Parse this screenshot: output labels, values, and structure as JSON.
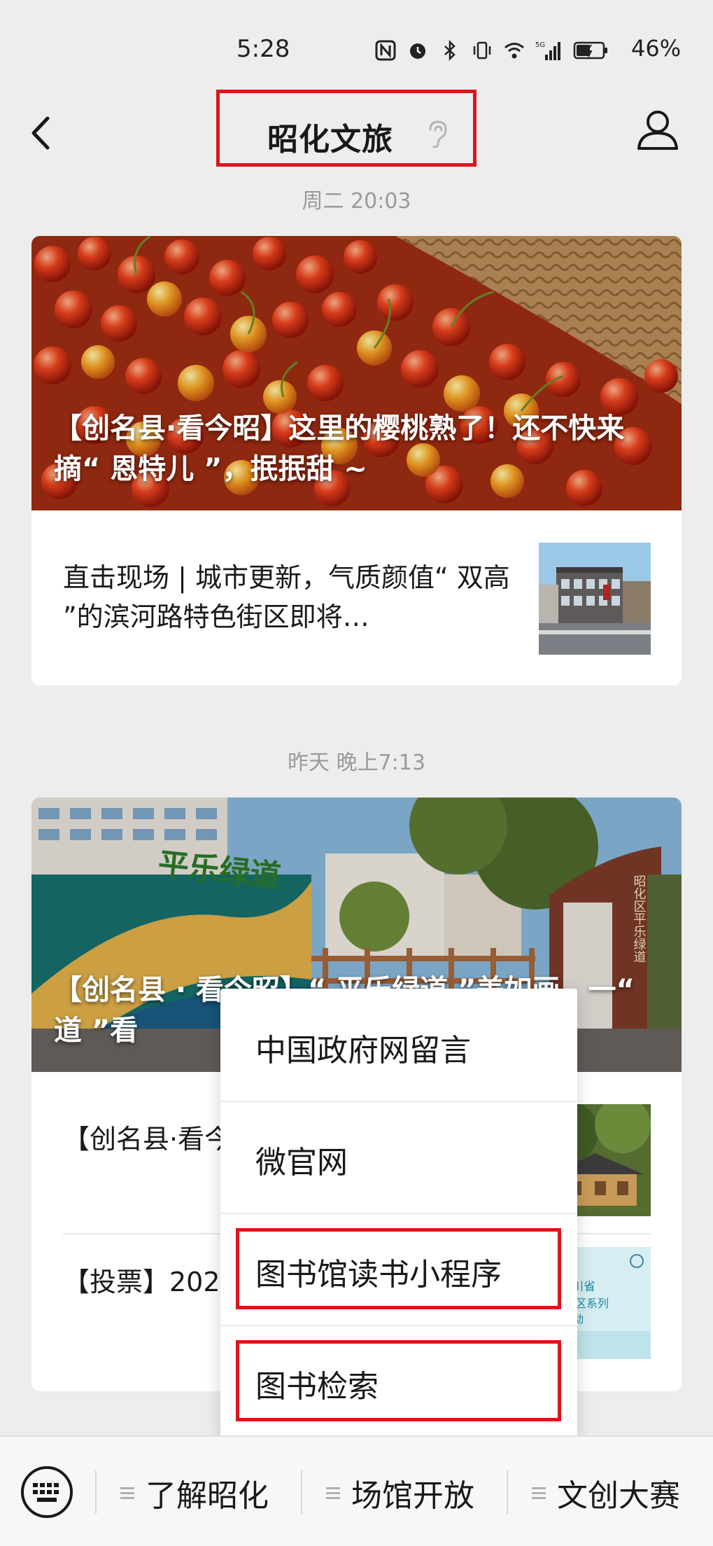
{
  "status_bar": {
    "time": "5:28",
    "battery_percent": "46%",
    "network_label": "5G",
    "icons": [
      "nfc-icon",
      "alarm-icon",
      "bluetooth-icon",
      "vibrate-icon",
      "wifi-icon",
      "signal-icon",
      "battery-icon"
    ]
  },
  "header": {
    "title": "昭化文旅",
    "back_icon": "chevron-left-icon",
    "ear_icon": "ear-icon",
    "profile_icon": "person-icon"
  },
  "feed": [
    {
      "timestamp": "周二 20:03",
      "cover_title": "【创名县·看今昭】这里的樱桃熟了！还不快来摘“ 恩特儿 ”，抿抿甜 ~",
      "sub_items": [
        {
          "title": "直击现场 | 城市更新，气质颜值“ 双高 ”的滨河路特色街区即将…"
        }
      ]
    },
    {
      "timestamp": "昨天 晚上7:13",
      "cover_title": "【创名县 · 看今昭】“ 平乐绿道 ”美如画，一“ 道 ”看",
      "cover_sign_text": "平乐绿道",
      "cover_plaque_text": "昭化区平乐绿道",
      "sub_items": [
        {
          "title": "【创名县·看今 个村入选首批"
        },
        {
          "title": "【投票】2023 系列推选活动",
          "thumb_text_1": "四川省",
          "thumb_text_2": "旅游景区系列",
          "thumb_text_3": "推选活动"
        }
      ]
    }
  ],
  "popup_menu": {
    "items": [
      {
        "label": "中国政府网留言"
      },
      {
        "label": "微官网"
      },
      {
        "label": "图书馆读书小程序"
      },
      {
        "label": "图书检索"
      }
    ],
    "highlight_color": "#d9161c"
  },
  "bottom_bar": {
    "keyboard_icon": "keyboard-icon",
    "menus": [
      {
        "label": "了解昭化"
      },
      {
        "label": "场馆开放"
      },
      {
        "label": "文创大赛"
      }
    ]
  }
}
